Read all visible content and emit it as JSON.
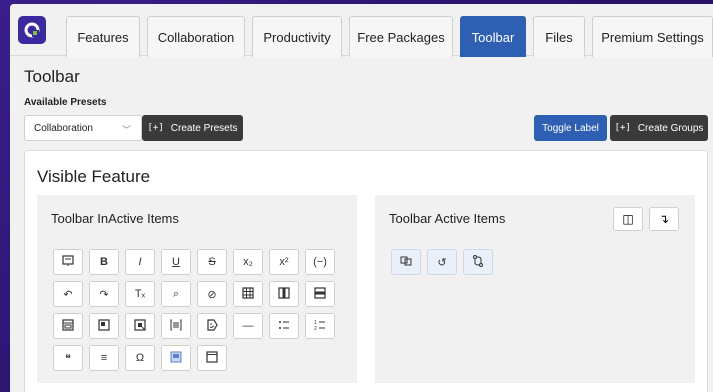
{
  "tabs": [
    {
      "label": "Features"
    },
    {
      "label": "Collaboration"
    },
    {
      "label": "Productivity"
    },
    {
      "label": "Free Packages"
    },
    {
      "label": "Toolbar"
    },
    {
      "label": "Files"
    },
    {
      "label": "Premium Settings"
    }
  ],
  "active_tab": "Toolbar",
  "page": {
    "title": "Toolbar"
  },
  "presets": {
    "label": "Available Presets",
    "selected": "Collaboration",
    "create_label": "Create Presets"
  },
  "actions": {
    "toggle_label": "Toggle Label",
    "create_groups_label": "Create Groups"
  },
  "visible_feature": {
    "title": "Visible Feature",
    "inactive_title": "Toolbar InActive Items",
    "active_title": "Toolbar Active Items",
    "inactive_items": [
      {
        "icon": "comment-icon"
      },
      {
        "icon": "bold-icon",
        "glyph": "B"
      },
      {
        "icon": "italic-icon",
        "glyph": "I"
      },
      {
        "icon": "underline-icon",
        "glyph": "U"
      },
      {
        "icon": "strikethrough-icon",
        "glyph": "S"
      },
      {
        "icon": "subscript-icon",
        "glyph": "x₂"
      },
      {
        "icon": "superscript-icon",
        "glyph": "x²"
      },
      {
        "icon": "code-inline-icon",
        "glyph": "(−)"
      },
      {
        "icon": "undo-icon",
        "glyph": "↶"
      },
      {
        "icon": "redo-icon",
        "glyph": "↷"
      },
      {
        "icon": "clear-format-icon",
        "glyph": "Tₓ"
      },
      {
        "icon": "find-replace-icon",
        "glyph": "⌕"
      },
      {
        "icon": "link-icon",
        "glyph": "⊘"
      },
      {
        "icon": "table-icon"
      },
      {
        "icon": "table-column-icon"
      },
      {
        "icon": "table-row-icon"
      },
      {
        "icon": "image-icon"
      },
      {
        "icon": "template-icon"
      },
      {
        "icon": "media-icon"
      },
      {
        "icon": "align-block-icon"
      },
      {
        "icon": "emoji-icon"
      },
      {
        "icon": "horizontal-rule-icon",
        "glyph": "—"
      },
      {
        "icon": "bullet-list-icon"
      },
      {
        "icon": "numbered-list-icon"
      },
      {
        "icon": "blockquote-icon",
        "glyph": "❝"
      },
      {
        "icon": "align-center-icon",
        "glyph": "≡"
      },
      {
        "icon": "special-character-icon",
        "glyph": "Ω"
      },
      {
        "icon": "embed-icon"
      },
      {
        "icon": "window-icon"
      }
    ],
    "active_items": [
      {
        "icon": "copy-format-icon"
      },
      {
        "icon": "history-icon",
        "glyph": "↺"
      },
      {
        "icon": "track-changes-icon"
      }
    ]
  },
  "colors": {
    "accent": "#2f5fb3",
    "dark_button": "#3a3a3a",
    "brand": "#3b2a9e"
  }
}
